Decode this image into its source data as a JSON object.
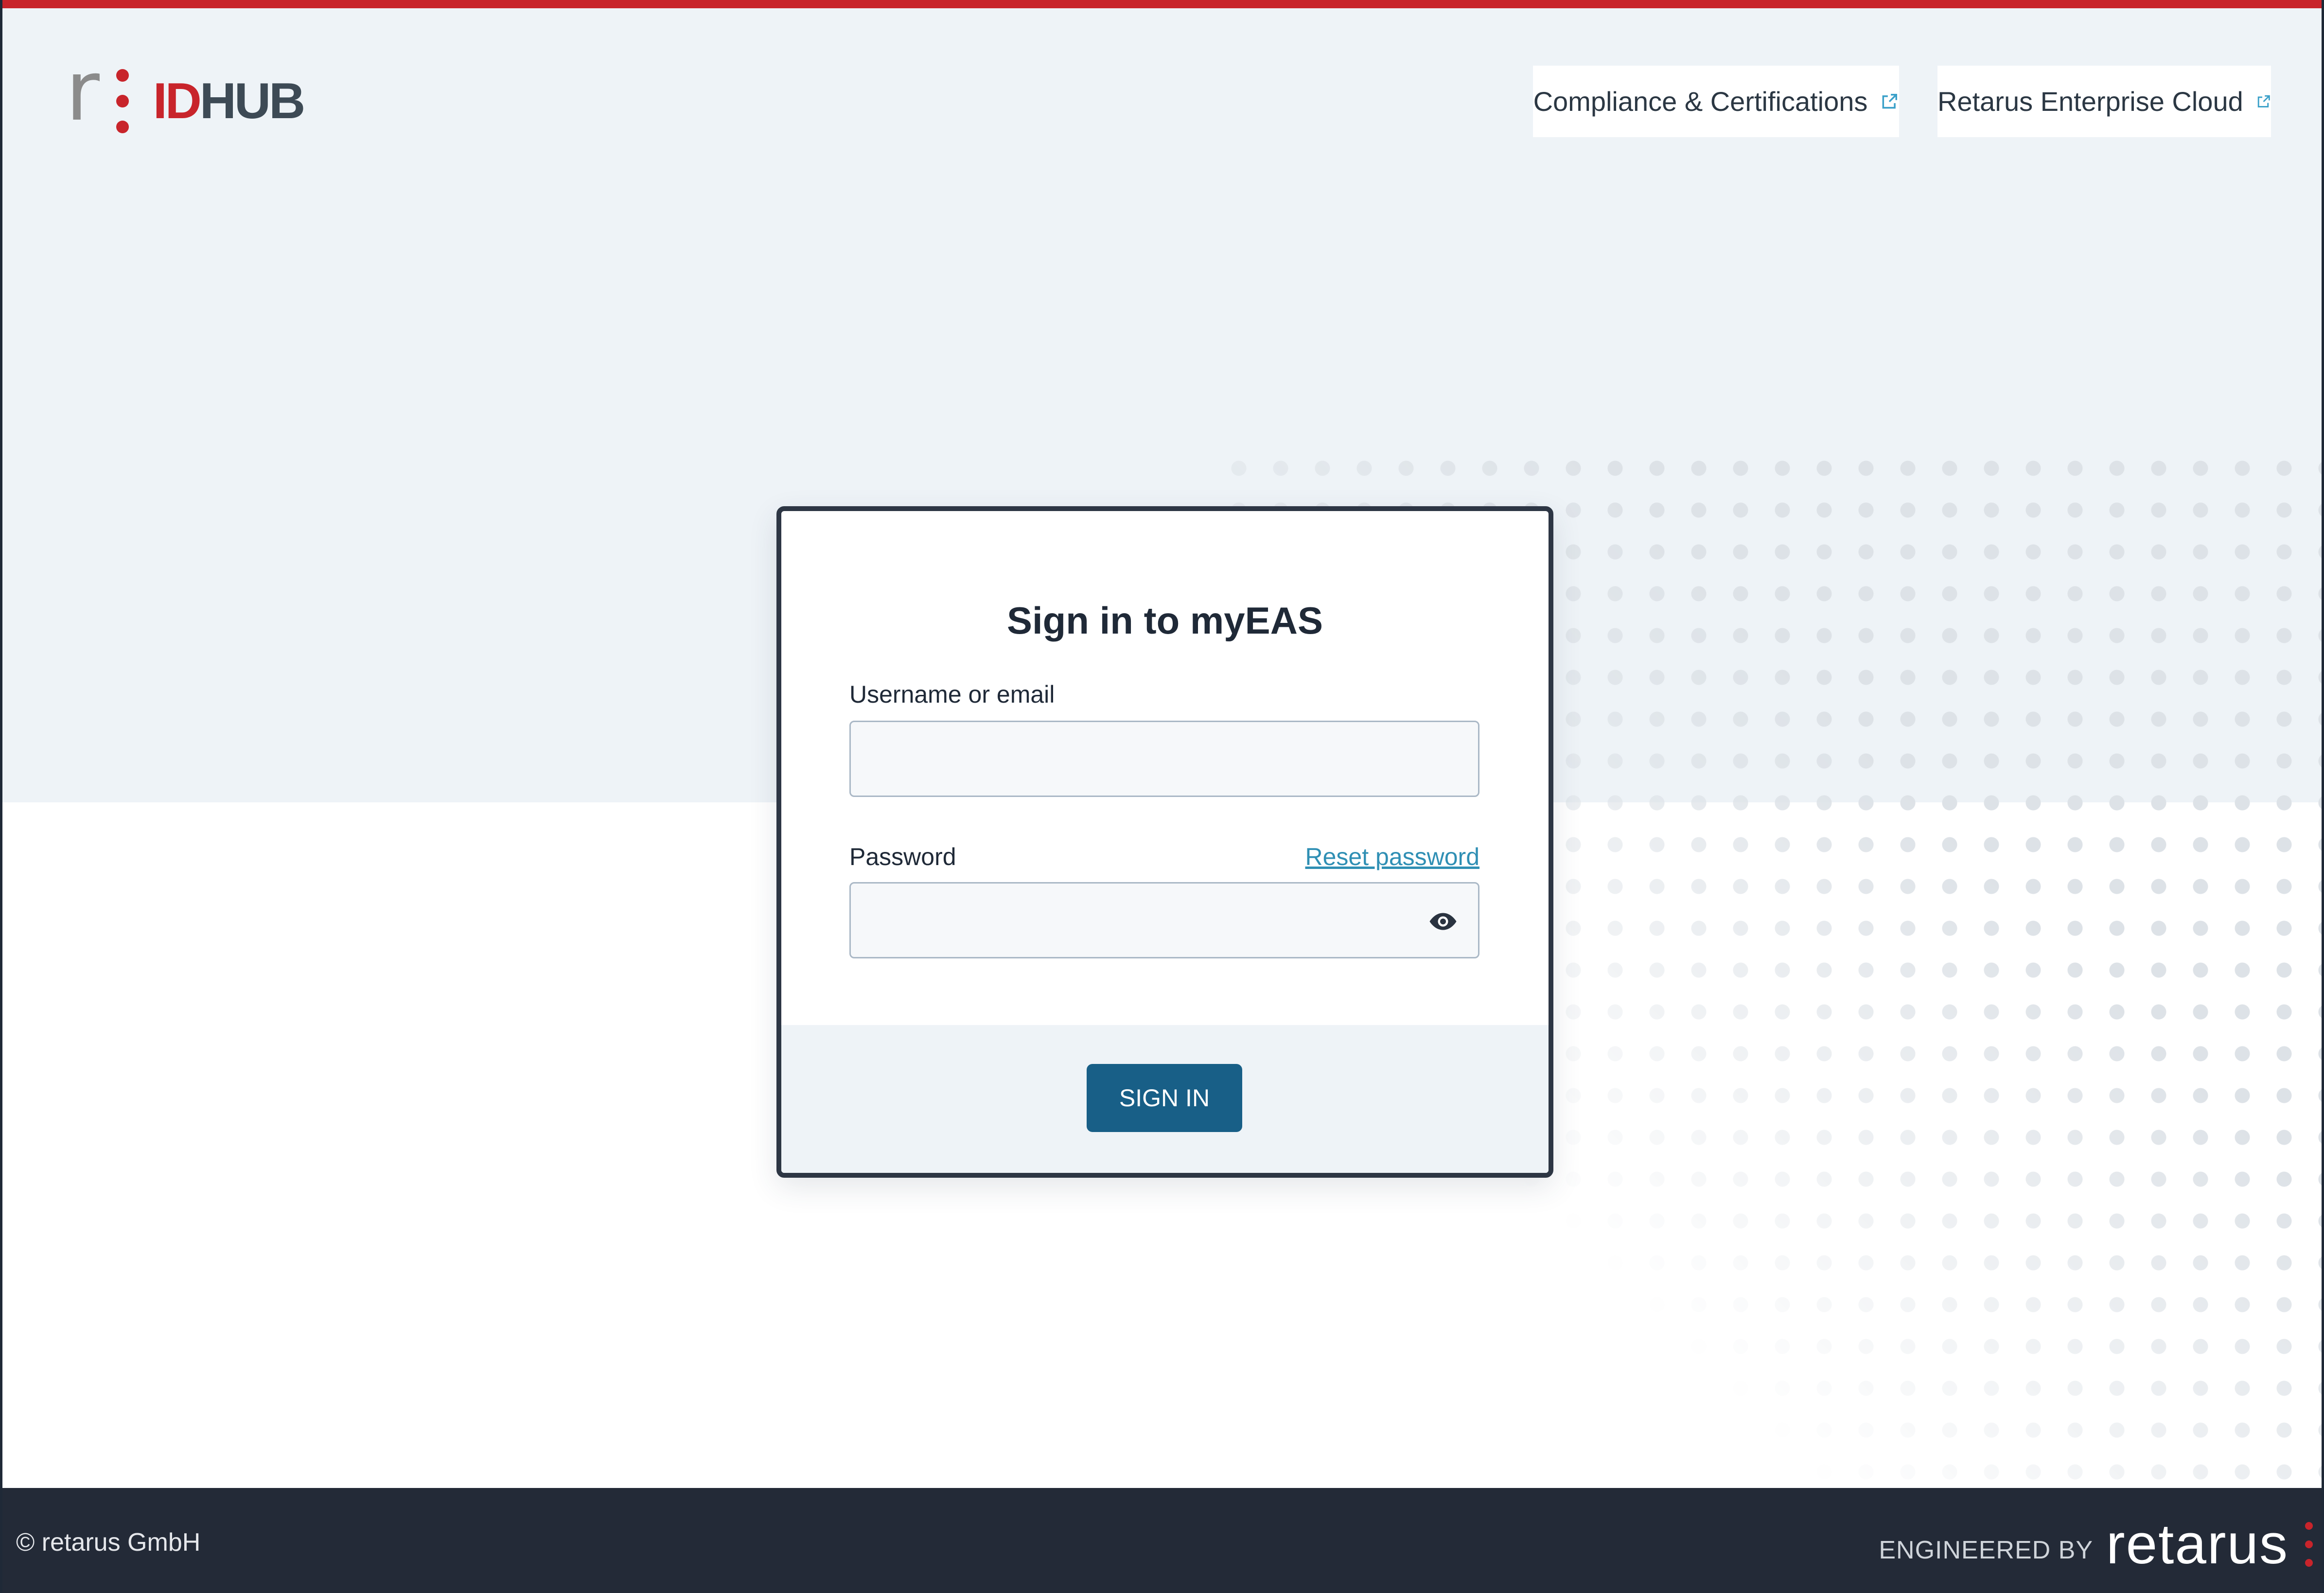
{
  "header": {
    "logo": {
      "id_text": "ID",
      "hub_text": "HUB",
      "r_glyph": "r",
      "accent_color": "#c8242b"
    },
    "links": [
      {
        "label": "Compliance & Certifications",
        "icon": "external-link-icon"
      },
      {
        "label": "Retarus Enterprise Cloud",
        "icon": "external-link-icon"
      }
    ]
  },
  "login": {
    "title": "Sign in to myEAS",
    "username_label": "Username or email",
    "username_value": "",
    "password_label": "Password",
    "password_value": "",
    "reset_label": "Reset password",
    "show_password_icon": "eye-icon",
    "submit_label": "SIGN IN",
    "submit_color": "#185f87"
  },
  "footer": {
    "copyright": "© retarus GmbH",
    "engineered_by": "ENGINEERED BY",
    "brand": "retarus"
  }
}
